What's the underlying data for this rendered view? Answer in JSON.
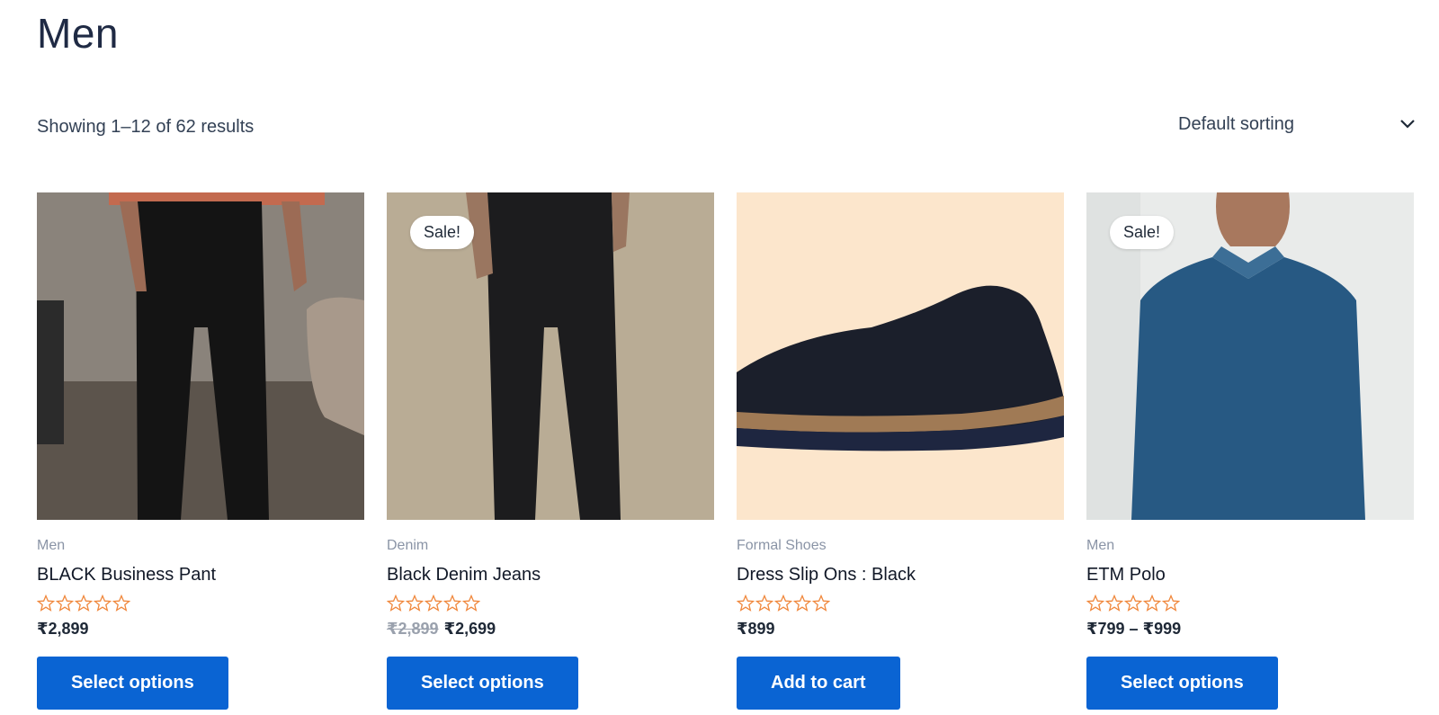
{
  "page": {
    "title": "Men"
  },
  "toolbar": {
    "result_count": "Showing 1–12 of 62 results",
    "sort_selected": "Default sorting"
  },
  "products": [
    {
      "category": "Men",
      "title": "BLACK Business Pant",
      "price": "₹2,899",
      "old_price": "",
      "sale_badge": "",
      "rating_stars": 0,
      "button": "Select options"
    },
    {
      "category": "Denim",
      "title": "Black Denim Jeans",
      "price": "₹2,699",
      "old_price": "₹2,899",
      "sale_badge": "Sale!",
      "rating_stars": 0,
      "button": "Select options"
    },
    {
      "category": "Formal Shoes",
      "title": "Dress Slip Ons : Black",
      "price": "₹899",
      "old_price": "",
      "sale_badge": "",
      "rating_stars": 0,
      "button": "Add to cart"
    },
    {
      "category": "Men",
      "title": "ETM Polo",
      "price": "₹799 – ₹999",
      "old_price": "",
      "sale_badge": "Sale!",
      "rating_stars": 0,
      "button": "Select options"
    }
  ],
  "colors": {
    "accent": "#0a64d3",
    "star": "#f0873c",
    "text": "#1f2937"
  }
}
